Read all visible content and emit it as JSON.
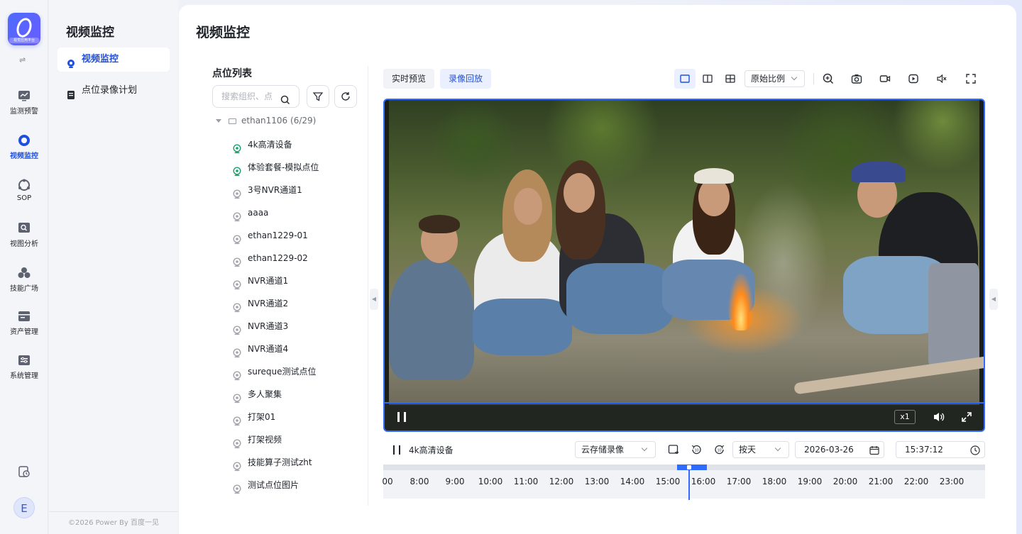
{
  "rail": {
    "logo_caption": "视觉应用平台",
    "items": [
      {
        "label": "监测预警",
        "icon": "monitor-warning-icon"
      },
      {
        "label": "视频监控",
        "icon": "video-monitor-icon",
        "active": true
      },
      {
        "label": "SOP",
        "icon": "sop-icon"
      },
      {
        "label": "视图分析",
        "icon": "view-analysis-icon"
      },
      {
        "label": "技能广场",
        "icon": "skill-square-icon"
      },
      {
        "label": "资产管理",
        "icon": "asset-management-icon"
      },
      {
        "label": "系统管理",
        "icon": "system-management-icon"
      }
    ],
    "avatar": "E"
  },
  "subnav": {
    "title": "视频监控",
    "items": [
      {
        "label": "视频监控",
        "active": true
      },
      {
        "label": "点位录像计划"
      }
    ],
    "footer": "©2026 Power By 百度一见"
  },
  "main": {
    "title": "视频监控",
    "tree": {
      "title": "点位列表",
      "search_placeholder": "搜索组织、点位",
      "root": "ethan1106 (6/29)",
      "items": [
        {
          "label": "4k高清设备",
          "online": true
        },
        {
          "label": "体验套餐-模拟点位",
          "online": true
        },
        {
          "label": "3号NVR通道1"
        },
        {
          "label": "aaaa"
        },
        {
          "label": "ethan1229-01"
        },
        {
          "label": "ethan1229-02"
        },
        {
          "label": "NVR通道1"
        },
        {
          "label": "NVR通道2"
        },
        {
          "label": "NVR通道3"
        },
        {
          "label": "NVR通道4"
        },
        {
          "label": "sureque测试点位"
        },
        {
          "label": "多人聚集"
        },
        {
          "label": "打架01"
        },
        {
          "label": "打架视频"
        },
        {
          "label": "技能算子测试zht"
        },
        {
          "label": "测试点位图片"
        }
      ]
    },
    "toolbar": {
      "tab_live": "实时预览",
      "tab_playback": "录像回放",
      "ratio": "原始比例"
    },
    "player": {
      "speed": "x1",
      "current_device": "4k高清设备",
      "storage": "云存储录像",
      "range": "按天",
      "date": "2026-03-26",
      "time": "15:37:12"
    },
    "timeline": {
      "ticks": [
        "00",
        "8:00",
        "9:00",
        "10:00",
        "11:00",
        "12:00",
        "13:00",
        "14:00",
        "15:00",
        "16:00",
        "17:00",
        "18:00",
        "19:00",
        "20:00",
        "21:00",
        "22:00",
        "23:00"
      ],
      "recorded_segment": [
        "15:10",
        "16:00"
      ],
      "cursor": "15:37:12"
    },
    "colors": {
      "accent": "#1f4fe0",
      "highlight": "#2f6bff",
      "online": "#16a36b"
    }
  }
}
